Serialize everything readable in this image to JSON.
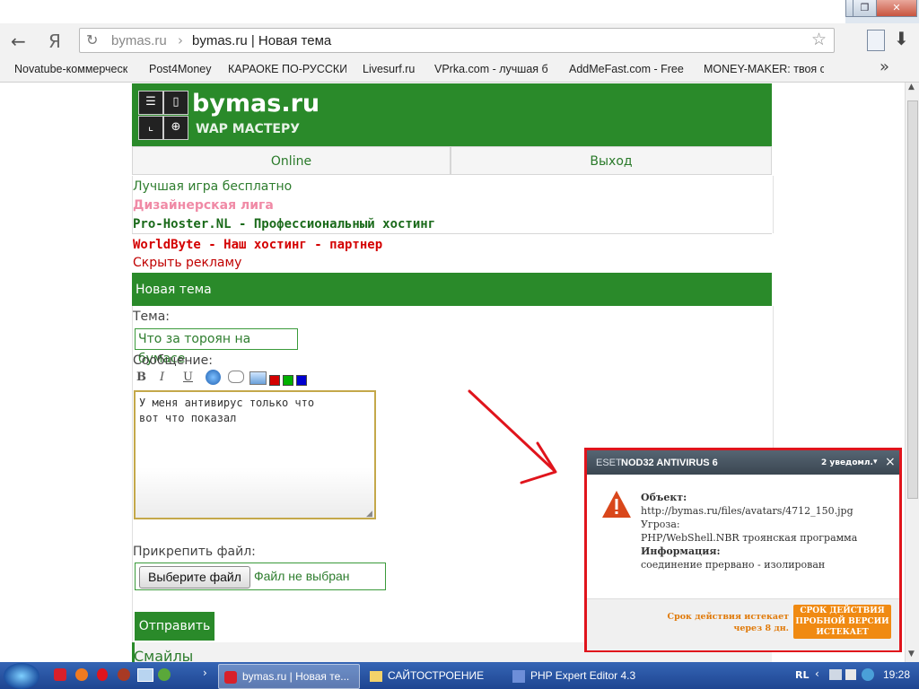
{
  "browser": {
    "address_host": "bymas.ru",
    "address_sep": "›",
    "address_title": "bymas.ru | Новая тема",
    "yandex_glyph": "Я",
    "bookmarks": [
      "Novatube-коммерческ",
      "Post4Money",
      "КАРАОКЕ ПО-РУССКИ:",
      "Livesurf.ru",
      "VPrka.com - лучшая б",
      "AddMeFast.com - Free",
      "MONEY-MAKER: твоя с"
    ],
    "bookmarks_more": "»"
  },
  "site": {
    "logo_title": "bymas.ru",
    "logo_sub": "WAP МАСТЕРУ",
    "nav_online": "Online",
    "nav_exit": "Выход",
    "ads": [
      {
        "text": "Лучшая игра бесплатно",
        "color": "#2e7d2e"
      },
      {
        "text": "Дизайнерская лига",
        "color": "#f08aa6"
      },
      {
        "text": "Pro-Hoster.NL - Профессиональный хостинг",
        "color": "#1a6a1a"
      },
      {
        "text": "WorldByte - Наш хостинг - партнер",
        "color": "#d40000"
      },
      {
        "text": "Скрыть рекламу",
        "color": "#c00000"
      }
    ],
    "section_title": "Новая тема",
    "theme_label": "Тема:",
    "theme_value": "Что за тороян на бумасе",
    "message_label": "Сообщение:",
    "toolbar": {
      "bold": "B",
      "italic": "I",
      "underline": "U"
    },
    "message_text": "У меня антивирус только что\nвот что показал",
    "attach_label": "Прикрепить файл:",
    "choose_file": "Выберите файл",
    "no_file": "Файл не выбран",
    "submit": "Отправить",
    "smiles": "Смайлы",
    "colors": [
      "#d40000",
      "#00b000",
      "#0000d0"
    ]
  },
  "popup": {
    "brand_eset": "ESET",
    "brand_product": "NOD32 ANTIVIRUS 6",
    "notifications": "2 уведомл.",
    "close": "×",
    "object_label": "Объект:",
    "object_value": "http://bymas.ru/files/avatars/4712_150.jpg",
    "threat_label": "Угроза:",
    "threat_value": "PHP/WebShell.NBR троянская программа",
    "info_label": "Информация:",
    "info_value": "соединение прервано - изолирован",
    "expire_note_1": "Срок действия истекает",
    "expire_note_2": "через 8 дн.",
    "expire_button": "СРОК ДЕЙСТВИЯ ПРОБНОЙ ВЕРСИИ ИСТЕКАЕТ"
  },
  "taskbar": {
    "tasks": [
      "bymas.ru | Новая те...",
      "САЙТОСТРОЕНИЕ",
      "PHP Expert Editor 4.3"
    ],
    "lang": "RL",
    "clock": "19:28"
  }
}
